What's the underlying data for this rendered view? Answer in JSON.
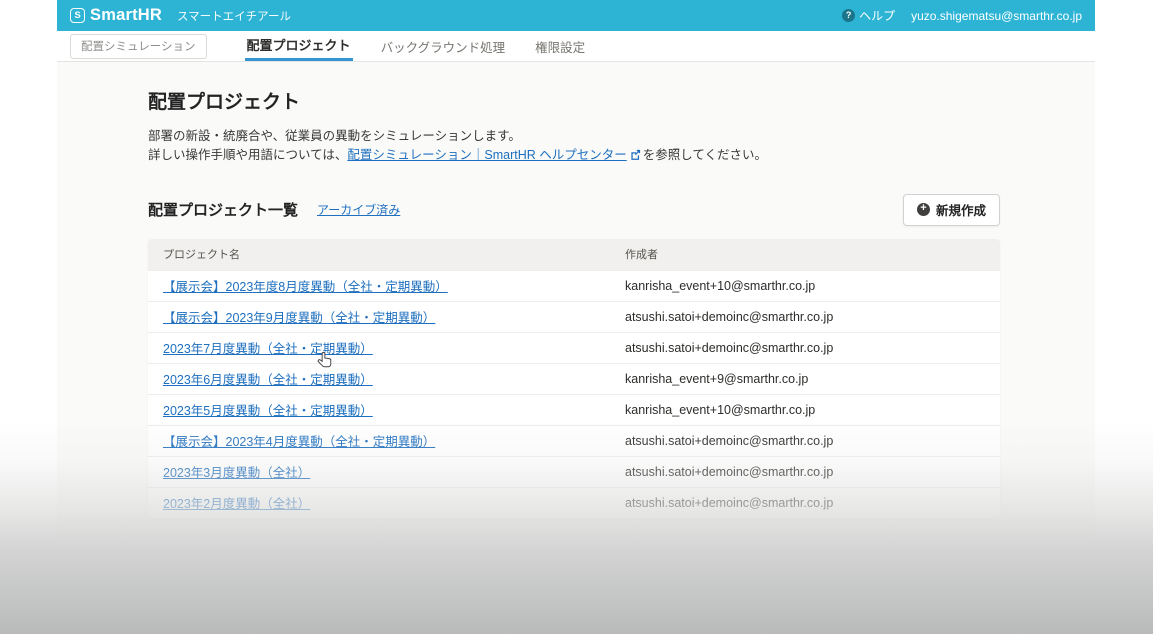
{
  "header": {
    "logo_mark": "S",
    "logo_text": "SmartHR",
    "logo_kana": "スマートエイチアール",
    "help_icon_glyph": "?",
    "help_label": "ヘルプ",
    "user_email": "yuzo.shigematsu@smarthr.co.jp"
  },
  "tabs": [
    {
      "label": "配置シミュレーション"
    },
    {
      "label": "配置プロジェクト",
      "active": true
    },
    {
      "label": "バックグラウンド処理"
    },
    {
      "label": "権限設定"
    }
  ],
  "page": {
    "title": "配置プロジェクト",
    "description_line1": "部署の新設・統廃合や、従業員の異動をシミュレーションします。",
    "description_line2_prefix": "詳しい操作手順や用語については、",
    "description_link_text": "配置シミュレーション｜SmartHR ヘルプセンター",
    "description_line2_suffix": "を参照してください。"
  },
  "list_section": {
    "heading": "配置プロジェクト一覧",
    "archived_link_label": "アーカイブ済み",
    "new_button_label": "新規作成",
    "plus_icon_glyph": "+"
  },
  "table": {
    "columns": [
      "プロジェクト名",
      "作成者"
    ],
    "rows": [
      {
        "name": "【展示会】2023年度8月度異動（全社・定期異動）",
        "creator": "kanrisha_event+10@smarthr.co.jp"
      },
      {
        "name": "【展示会】2023年9月度異動（全社・定期異動）",
        "creator": "atsushi.satoi+demoinc@smarthr.co.jp"
      },
      {
        "name": "2023年7月度異動（全社・定期異動）",
        "creator": "atsushi.satoi+demoinc@smarthr.co.jp"
      },
      {
        "name": "2023年6月度異動（全社・定期異動）",
        "creator": "kanrisha_event+9@smarthr.co.jp"
      },
      {
        "name": "2023年5月度異動（全社・定期異動）",
        "creator": "kanrisha_event+10@smarthr.co.jp"
      },
      {
        "name": "【展示会】2023年4月度異動（全社・定期異動）",
        "creator": "atsushi.satoi+demoinc@smarthr.co.jp"
      },
      {
        "name": "2023年3月度異動（全社）",
        "creator": "atsushi.satoi+demoinc@smarthr.co.jp"
      },
      {
        "name": "2023年2月度異動（全社）",
        "creator": "atsushi.satoi+demoinc@smarthr.co.jp"
      }
    ]
  },
  "colors": {
    "brand_teal": "#2db4d5",
    "link_blue": "#1e6fbf",
    "active_tab_underline": "#3396d2",
    "table_header_bg": "#f1f0ee"
  }
}
